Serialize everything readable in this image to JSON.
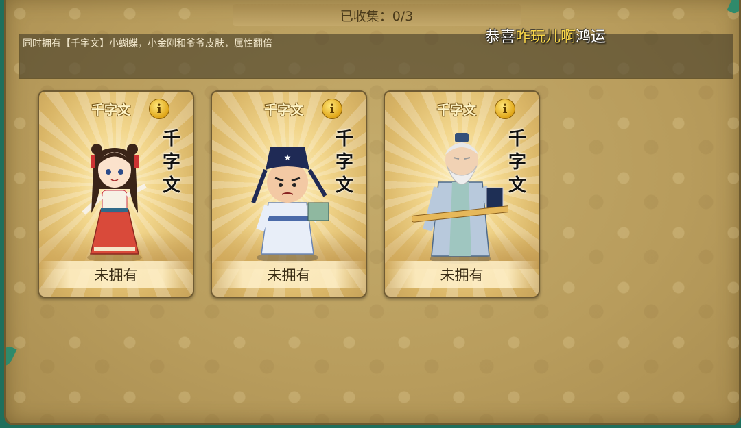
{
  "header": {
    "collected": "已收集：0/3"
  },
  "description": "同时拥有【千字文】小蝴蝶，小金刚和爷爷皮肤，属性翻倍",
  "marquee": {
    "prefix": "恭喜",
    "player": "咋玩儿啊",
    "suffix": "鸿运"
  },
  "cards": [
    {
      "name": "千字文",
      "calligraphy": [
        "千",
        "字",
        "文"
      ],
      "status": "未拥有",
      "character": "girl-red-dress"
    },
    {
      "name": "千字文",
      "calligraphy": [
        "千",
        "字",
        "文"
      ],
      "status": "未拥有",
      "character": "scholar-boy-blue"
    },
    {
      "name": "千字文",
      "calligraphy": [
        "千",
        "字",
        "文"
      ],
      "status": "未拥有",
      "character": "old-sage-grey"
    }
  ],
  "colors": {
    "panel": "#b89c5c",
    "card_gold": "#f2d68c",
    "highlight_text": "#f7d44a",
    "frame_teal": "#1f6f5c"
  },
  "icons": {
    "info": "info-icon"
  }
}
